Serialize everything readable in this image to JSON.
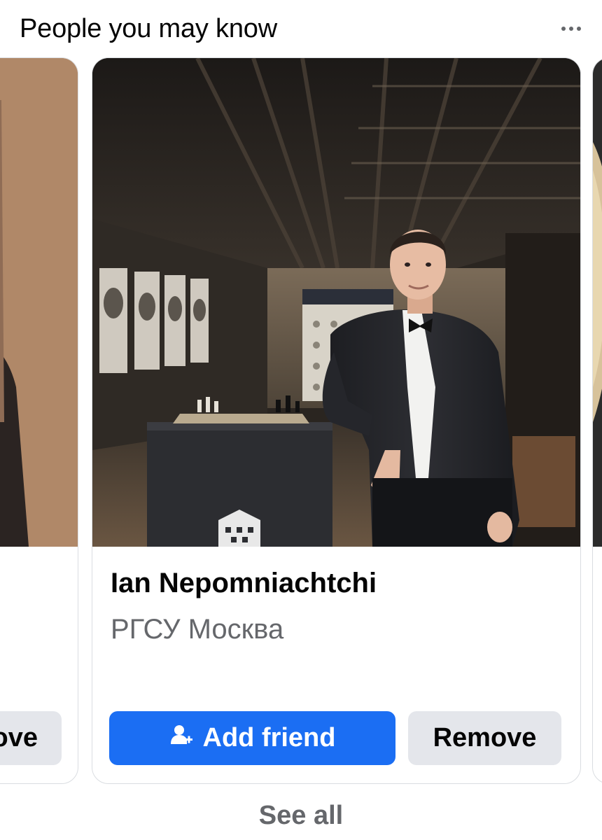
{
  "section": {
    "title": "People you may know"
  },
  "cards": {
    "left": {
      "remove_label": "ove"
    },
    "main": {
      "name": "Ian Nepomniachtchi",
      "subtitle": "РГСУ Москва",
      "add_label": "Add friend",
      "remove_label": "Remove"
    }
  },
  "footer": {
    "see_all_label": "See all"
  },
  "colors": {
    "accent": "#1b6ef3",
    "secondary_button": "#e4e6eb",
    "muted_text": "#65676b"
  },
  "icons": {
    "more": "more-dots-icon",
    "add_friend": "person-add-icon"
  }
}
